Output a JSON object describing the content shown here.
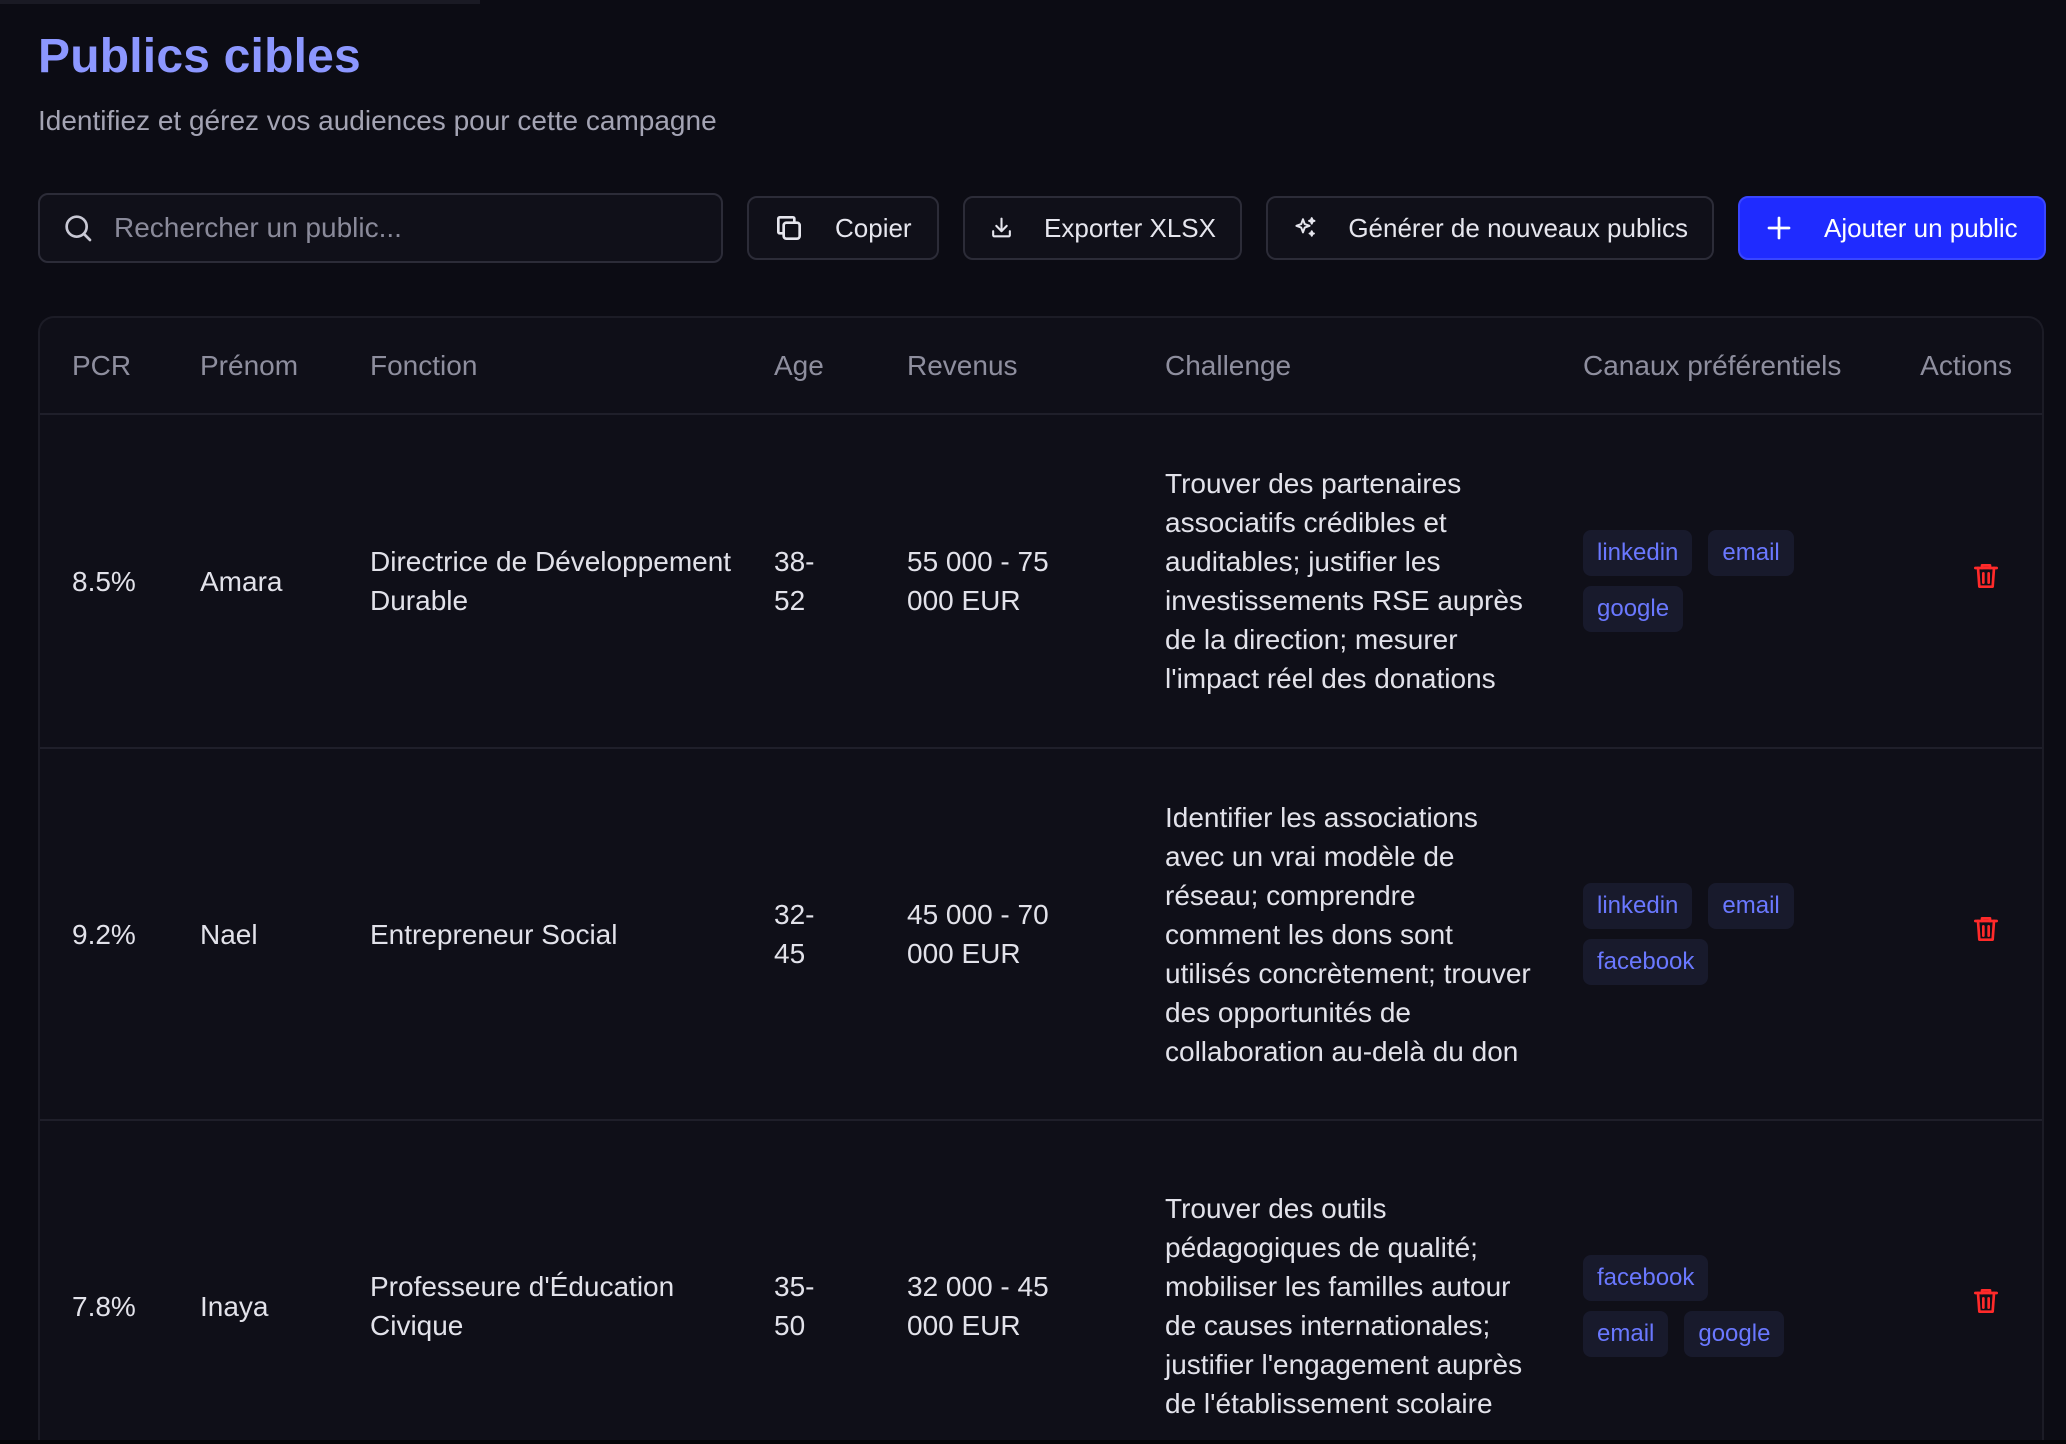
{
  "header": {
    "title": "Publics cibles",
    "subtitle": "Identifiez et gérez vos audiences pour cette campagne"
  },
  "toolbar": {
    "search_placeholder": "Rechercher un public...",
    "copy_label": "Copier",
    "export_label": "Exporter XLSX",
    "generate_label": "Générer de nouveaux publics",
    "add_label": "Ajouter un public"
  },
  "table": {
    "columns": {
      "pcr": "PCR",
      "prenom": "Prénom",
      "fonction": "Fonction",
      "age": "Age",
      "revenus": "Revenus",
      "challenge": "Challenge",
      "canaux": "Canaux préférentiels",
      "actions": "Actions"
    },
    "rows": [
      {
        "pcr": "8.5%",
        "prenom": "Amara",
        "fonction": "Directrice de Développement Durable",
        "age": "38-52",
        "revenus": "55 000 - 75 000 EUR",
        "challenge": "Trouver des partenaires associatifs crédibles et auditables; justifier les investissements RSE auprès de la direction; mesurer l'impact réel des donations",
        "canaux": [
          "linkedin",
          "email",
          "google"
        ]
      },
      {
        "pcr": "9.2%",
        "prenom": "Nael",
        "fonction": "Entrepreneur Social",
        "age": "32-45",
        "revenus": "45 000 - 70 000 EUR",
        "challenge": "Identifier les associations avec un vrai modèle de réseau; comprendre comment les dons sont utilisés concrètement; trouver des opportunités de collaboration au-delà du don",
        "canaux": [
          "linkedin",
          "email",
          "facebook"
        ]
      },
      {
        "pcr": "7.8%",
        "prenom": "Inaya",
        "fonction": "Professeure d'Éducation Civique",
        "age": "35-50",
        "revenus": "32 000 - 45 000 EUR",
        "challenge": "Trouver des outils pédagogiques de qualité; mobiliser les familles autour de causes internationales; justifier l'engagement auprès de l'établissement scolaire",
        "canaux": [
          "facebook",
          "email",
          "google"
        ]
      }
    ]
  },
  "colors": {
    "background": "#0c0c14",
    "title": "#8c97ff",
    "accent_button": "#1f2bff",
    "tag_text": "#6a78ff",
    "delete_icon": "#ff2a2a"
  },
  "icons": {
    "search": "search-icon",
    "copy": "copy-icon",
    "export": "download-icon",
    "generate": "sparkles-icon",
    "add": "plus-icon",
    "delete": "trash-icon"
  }
}
